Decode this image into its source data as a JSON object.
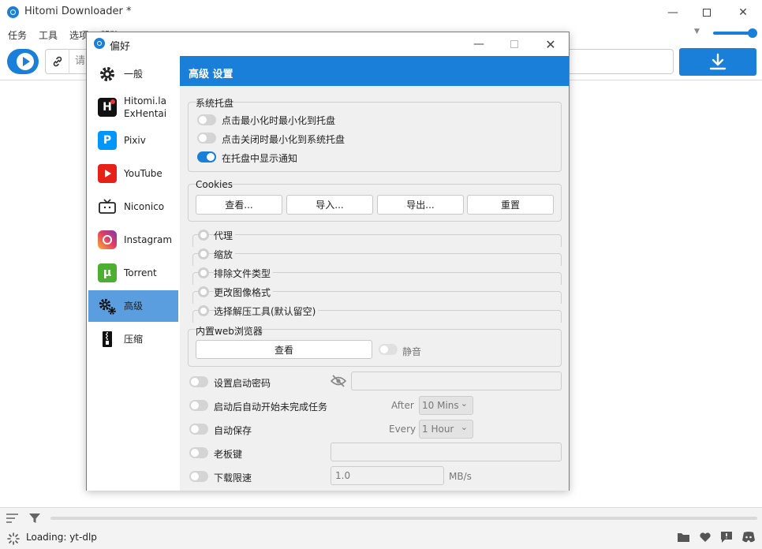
{
  "main": {
    "title": "Hitomi Downloader *",
    "menu": [
      "任务",
      "工具",
      "选项",
      "帮助"
    ],
    "url_placeholder": "请",
    "status": "Loading: yt-dlp"
  },
  "dialog": {
    "title": "偏好",
    "sidebar": [
      {
        "label": "一般",
        "icon": "gear-icon"
      },
      {
        "label": "Hitomi.la\nExHentai",
        "icon": "hitomi-icon"
      },
      {
        "label": "Pixiv",
        "icon": "pixiv-icon"
      },
      {
        "label": "YouTube",
        "icon": "youtube-icon"
      },
      {
        "label": "Niconico",
        "icon": "niconico-icon"
      },
      {
        "label": "Instagram",
        "icon": "instagram-icon"
      },
      {
        "label": "Torrent",
        "icon": "torrent-icon"
      },
      {
        "label": "高级",
        "icon": "gears-icon",
        "active": true
      },
      {
        "label": "压缩",
        "icon": "zip-icon"
      }
    ],
    "header": "高级 设置",
    "tray": {
      "title": "系统托盘",
      "options": [
        {
          "label": "点击最小化时最小化到托盘",
          "on": false
        },
        {
          "label": "点击关闭时最小化到系统托盘",
          "on": false
        },
        {
          "label": "在托盘中显示通知",
          "on": true
        }
      ]
    },
    "cookies": {
      "title": "Cookies",
      "buttons": [
        "查看...",
        "导入...",
        "导出...",
        "重置"
      ]
    },
    "radios": [
      "代理",
      "缩放",
      "排除文件类型",
      "更改图像格式",
      "选择解压工具(默认留空)"
    ],
    "browser": {
      "title": "内置web浏览器",
      "view": "查看",
      "mute": "静音"
    },
    "settings": {
      "password": "设置启动密码",
      "autostart": "启动后自动开始未完成任务",
      "after_label": "After",
      "after_value": "10 Mins",
      "autosave": "自动保存",
      "every_label": "Every",
      "every_value": "1 Hour",
      "bosskey": "老板键",
      "speed": "下载限速",
      "speed_value": "1.0",
      "speed_unit": "MB/s"
    }
  }
}
